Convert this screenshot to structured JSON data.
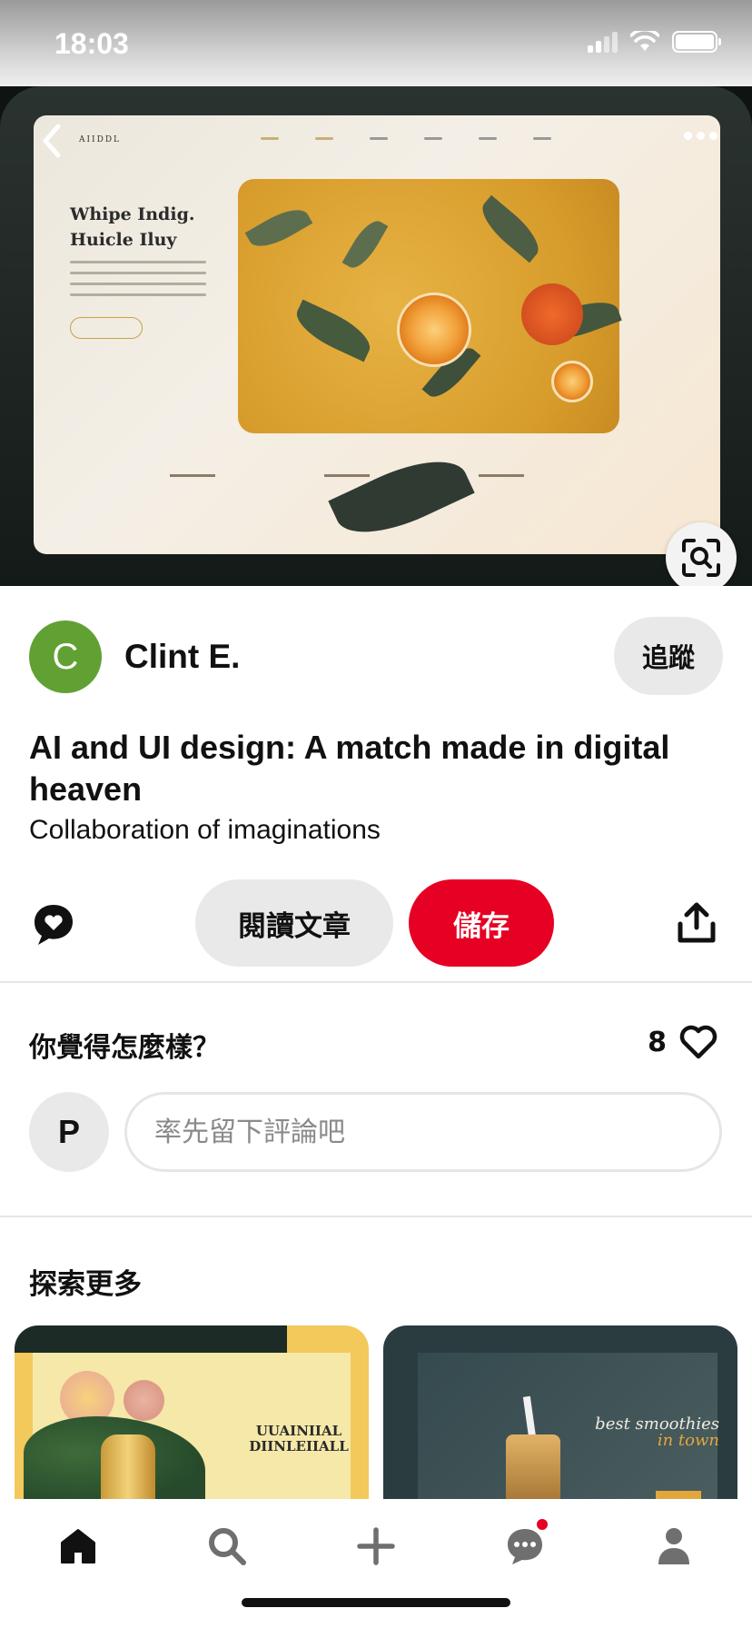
{
  "status_bar": {
    "time": "18:03"
  },
  "author": {
    "avatar_initial": "C",
    "name": "Clint E.",
    "follow_label": "追蹤"
  },
  "pin": {
    "title": "AI and UI design: A match made in digital heaven",
    "subtitle": "Collaboration of imaginations"
  },
  "actions": {
    "read_label": "閱讀文章",
    "save_label": "儲存"
  },
  "comments": {
    "heading": "你覺得怎麼樣？",
    "like_count": "8",
    "user_initial": "P",
    "placeholder": "率先留下評論吧"
  },
  "explore": {
    "title": "探索更多",
    "cards": [
      {
        "headline": "UUAINIIAL DIINLEIIALL"
      },
      {
        "headline": "best smoothies",
        "headline_accent": "in town"
      }
    ]
  },
  "hero_image": {
    "brand": "AIIDDL",
    "headline": "Whipe Indig. Huicle Iluy"
  },
  "colors": {
    "brand_red": "#e60023",
    "avatar_green": "#61a134",
    "button_gray": "#e9e9e9"
  },
  "icons": [
    "back-icon",
    "more-icon",
    "visual-search-icon",
    "reaction-heart-icon",
    "share-icon",
    "heart-icon",
    "home-icon",
    "search-icon",
    "create-icon",
    "messages-icon",
    "profile-icon"
  ]
}
